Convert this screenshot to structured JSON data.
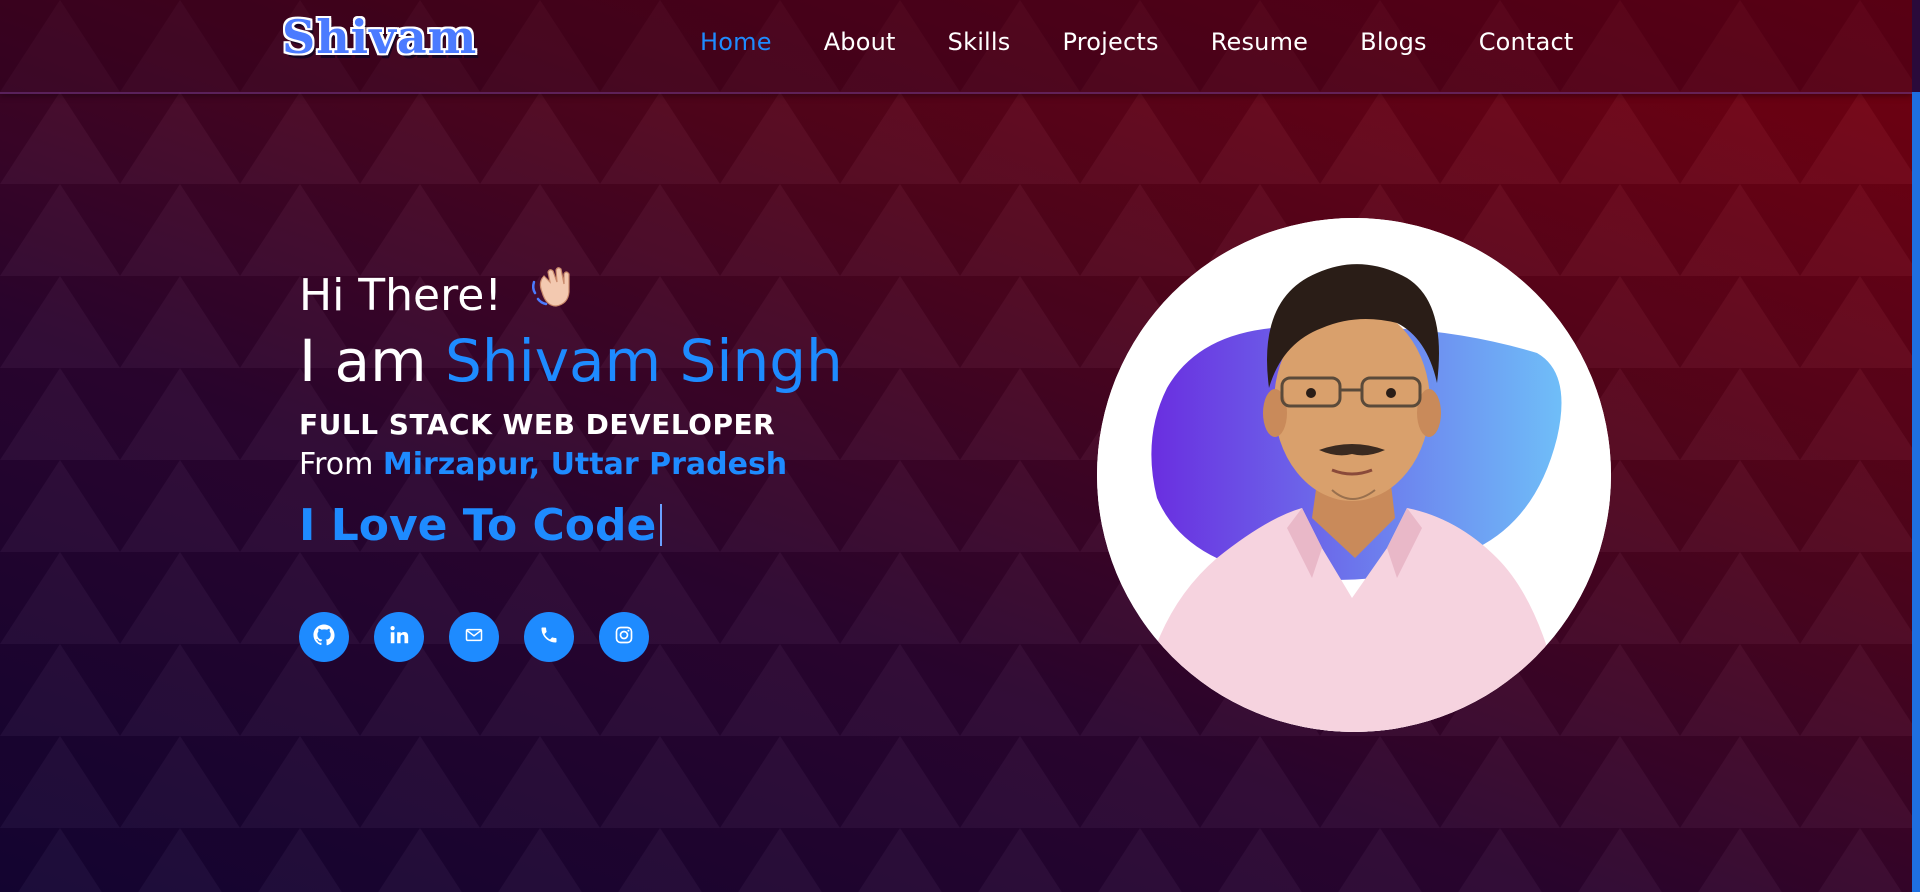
{
  "header": {
    "logo_text": "Shivam",
    "nav": [
      {
        "label": "Home",
        "active": true
      },
      {
        "label": "About"
      },
      {
        "label": "Skills"
      },
      {
        "label": "Projects"
      },
      {
        "label": "Resume"
      },
      {
        "label": "Blogs"
      },
      {
        "label": "Contact"
      }
    ]
  },
  "hero": {
    "greeting": "Hi There!",
    "greeting_emoji": "waving-hand",
    "intro_prefix": "I am",
    "name": "Shivam Singh",
    "role": "FULL STACK WEB DEVELOPER",
    "location_prefix": "From",
    "location": "Mirzapur, Uttar Pradesh",
    "typed_text": "I Love To Code"
  },
  "social_links": [
    {
      "icon": "github-icon"
    },
    {
      "icon": "linkedin-icon"
    },
    {
      "icon": "email-icon"
    },
    {
      "icon": "phone-icon"
    },
    {
      "icon": "instagram-icon"
    }
  ],
  "colors": {
    "accent": "#1e8bff",
    "background_top_right": "#7a0010",
    "background_bottom_left": "#140433",
    "text": "#ffffff"
  }
}
